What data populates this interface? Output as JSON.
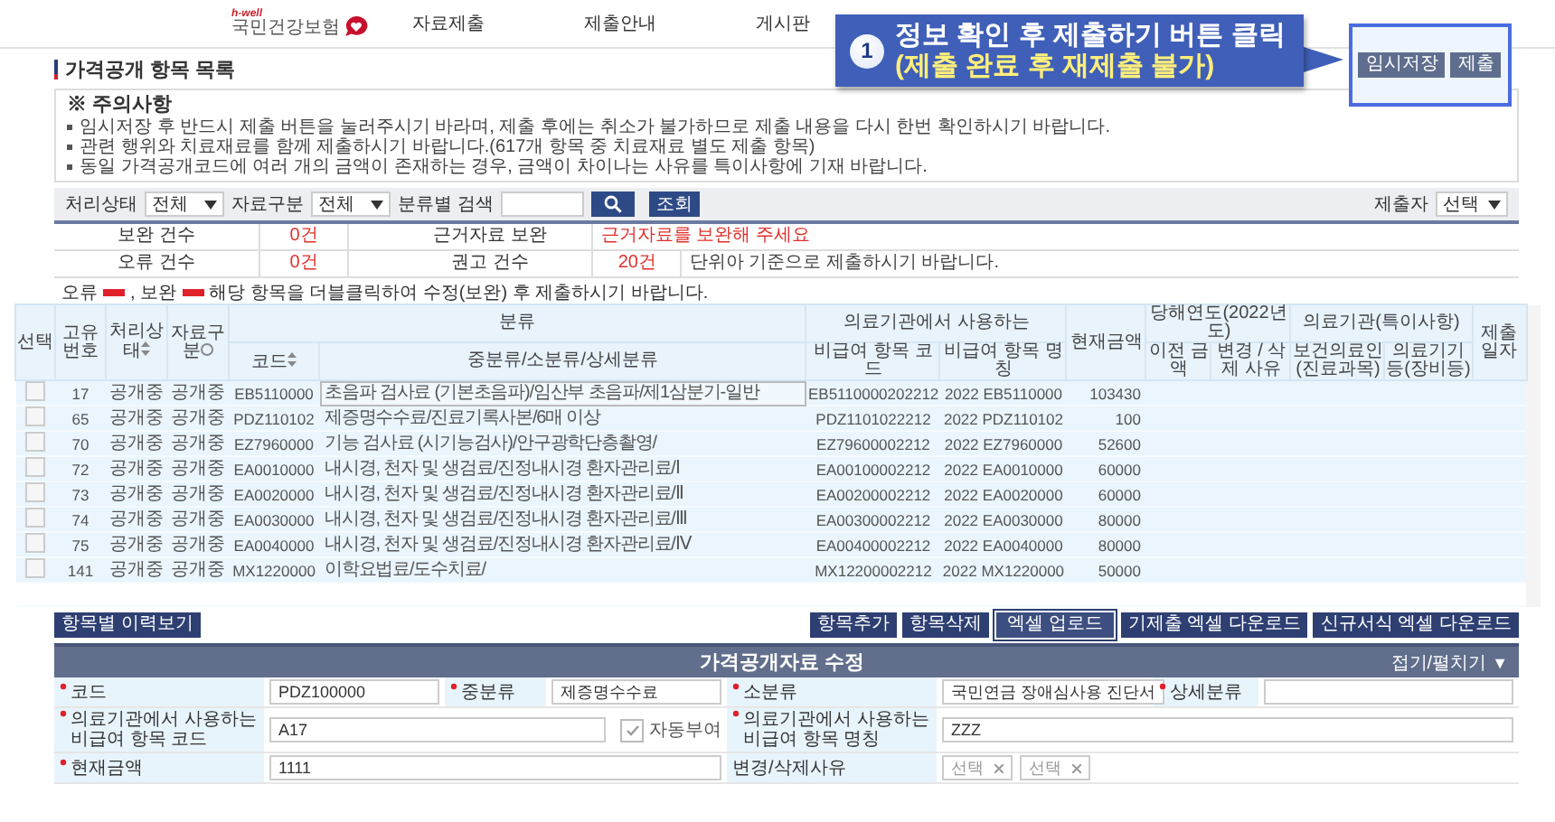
{
  "header": {
    "logo_tag": "h-well",
    "logo": "국민건강보험",
    "nav": [
      "자료제출",
      "제출안내",
      "게시판"
    ]
  },
  "callout": {
    "number": "1",
    "line1": "정보 확인 후 제출하기 버튼 클릭",
    "line2": "(제출 완료 후 재제출 불가)",
    "buttons": [
      "임시저장",
      "제출"
    ]
  },
  "page_title": "가격공개 항목 목록",
  "notice": {
    "title": "※ 주의사항",
    "items": [
      "임시저장 후 반드시 제출 버튼을 눌러주시기 바라며, 제출 후에는 취소가 불가하므로 제출 내용을 다시 한번 확인하시기 바랍니다.",
      "관련 행위와 치료재료를 함께 제출하시기 바랍니다.(617개 항목 중 치료재료 별도 제출 항목)",
      "동일 가격공개코드에 여러 개의 금액이 존재하는 경우, 금액이 차이나는 사유를 특이사항에 기재 바랍니다."
    ]
  },
  "filters": [
    {
      "kind": "select",
      "label": "처리상태",
      "value": "전체"
    },
    {
      "kind": "select",
      "label": "자료구분",
      "value": "전체"
    },
    {
      "kind": "search",
      "label": "분류별 검색"
    }
  ],
  "query_button": "조회",
  "submitter": {
    "label": "제출자",
    "value": "선택"
  },
  "summary": [
    {
      "label": "보완 건수",
      "value": "0건",
      "right_label": "근거자료 보완",
      "right_value": "근거자료를 보완해 주세요"
    },
    {
      "label": "오류 건수",
      "value": "0건",
      "right_label": "권고 건수",
      "right_value": "20건",
      "note": "단위아 기준으로 제출하시기 바랍니다."
    }
  ],
  "legend": {
    "error": "오류",
    "fix": ", 보완",
    "text": "해당 항목을 더블클릭하여 수정(보완) 후 제출하시기 바랍니다."
  },
  "table": {
    "columns": [
      {
        "label": "선택"
      },
      {
        "label": "고유번호"
      },
      {
        "label": "처리상태",
        "sort": true
      },
      {
        "label": "자료구분",
        "info": true
      },
      {
        "label": "분류",
        "children": [
          {
            "label": "코드",
            "sort": true
          },
          {
            "label": "중분류/소분류/상세분류"
          }
        ]
      },
      {
        "label": "의료기관에서 사용하는",
        "children": [
          {
            "label": "비급여 항목 코드"
          },
          {
            "label": "비급여 항목 명칭"
          }
        ]
      },
      {
        "label": "현재금액"
      },
      {
        "label": "당해연도(2022년도)",
        "children": [
          {
            "label": "이전 금액"
          },
          {
            "label": "변경 / 삭제 사유"
          }
        ]
      },
      {
        "label": "의료기관(특이사항)",
        "children": [
          {
            "label": "보건의료인(진료과목)"
          },
          {
            "label": "의료기기등(장비등)"
          }
        ]
      },
      {
        "label": "제출일자"
      }
    ],
    "rows": [
      {
        "checked": false,
        "selected": true,
        "id": "17",
        "status": "공개중",
        "type": "공개중",
        "code": "EB5110000",
        "category": "초음파 검사료 (기본초음파)/임산부 초음파/제1삼분기-일반",
        "item_code": "EB5110000202212",
        "item_name": "2022 EB5110000",
        "amount": "103430"
      },
      {
        "checked": false,
        "selected": false,
        "id": "65",
        "status": "공개중",
        "type": "공개중",
        "code": "PDZ110102",
        "category": "제증명수수료/진료기록사본/6매 이상",
        "item_code": "PDZ1101022212",
        "item_name": "2022 PDZ110102",
        "amount": "100"
      },
      {
        "checked": false,
        "selected": false,
        "id": "70",
        "status": "공개중",
        "type": "공개중",
        "code": "EZ7960000",
        "category": "기능 검사료 (시기능검사)/안구광학단층촬영/",
        "item_code": "EZ79600002212",
        "item_name": "2022 EZ7960000",
        "amount": "52600"
      },
      {
        "checked": false,
        "selected": false,
        "id": "72",
        "status": "공개중",
        "type": "공개중",
        "code": "EA0010000",
        "category": "내시경, 천자 및 생검료/진정내시경 환자관리료/Ⅰ",
        "item_code": "EA00100002212",
        "item_name": "2022 EA0010000",
        "amount": "60000"
      },
      {
        "checked": false,
        "selected": false,
        "id": "73",
        "status": "공개중",
        "type": "공개중",
        "code": "EA0020000",
        "category": "내시경, 천자 및 생검료/진정내시경 환자관리료/Ⅱ",
        "item_code": "EA00200002212",
        "item_name": "2022 EA0020000",
        "amount": "60000"
      },
      {
        "checked": false,
        "selected": false,
        "id": "74",
        "status": "공개중",
        "type": "공개중",
        "code": "EA0030000",
        "category": "내시경, 천자 및 생검료/진정내시경 환자관리료/Ⅲ",
        "item_code": "EA00300002212",
        "item_name": "2022 EA0030000",
        "amount": "80000"
      },
      {
        "checked": false,
        "selected": false,
        "id": "75",
        "status": "공개중",
        "type": "공개중",
        "code": "EA0040000",
        "category": "내시경, 천자 및 생검료/진정내시경 환자관리료/Ⅳ",
        "item_code": "EA00400002212",
        "item_name": "2022 EA0040000",
        "amount": "80000"
      },
      {
        "checked": false,
        "selected": false,
        "id": "141",
        "status": "공개중",
        "type": "공개중",
        "code": "MX1220000",
        "category": "이학요법료/도수치료/",
        "item_code": "MX12200002212",
        "item_name": "2022 MX1220000",
        "amount": "50000"
      }
    ]
  },
  "history_button": "항목별 이력보기",
  "actions": [
    {
      "label": "항목추가",
      "emphasized": false
    },
    {
      "label": "항목삭제",
      "emphasized": false
    },
    {
      "label": "엑셀 업로드",
      "emphasized": true
    },
    {
      "label": "기제출 엑셀 다운로드",
      "emphasized": false
    },
    {
      "label": "신규서식 엑셀 다운로드",
      "emphasized": false
    }
  ],
  "form": {
    "title": "가격공개자료 수정",
    "toggle": "접기/펼치기",
    "toggle_icon": "▼",
    "rows": [
      [
        {
          "kind": "text",
          "label": "코드",
          "required": true,
          "value": "PDZ100000"
        },
        {
          "kind": "text",
          "label": "중분류",
          "required": true,
          "value": "제증명수수료"
        },
        {
          "kind": "text",
          "label": "소분류",
          "required": true,
          "value": "국민연금 장애심사용 진단서"
        },
        {
          "kind": "text",
          "label": "상세분류",
          "required": true
        }
      ],
      [
        {
          "kind": "text",
          "label": "의료기관에서 사용하는",
          "label2": "비급여 항목 코드",
          "required": true,
          "value": "A17",
          "auto": {
            "label": "자동부여",
            "checked": true
          }
        },
        {
          "kind": "text",
          "label": "의료기관에서 사용하는",
          "label2": "비급여 항목 명칭",
          "required": true,
          "value": "ZZZ"
        }
      ],
      [
        {
          "kind": "text",
          "label": "현재금액",
          "required": true,
          "value": "1111"
        },
        {
          "kind": "selects",
          "label": "변경/삭제사유",
          "required": false,
          "values": [
            "선택",
            "선택"
          ]
        }
      ]
    ]
  }
}
